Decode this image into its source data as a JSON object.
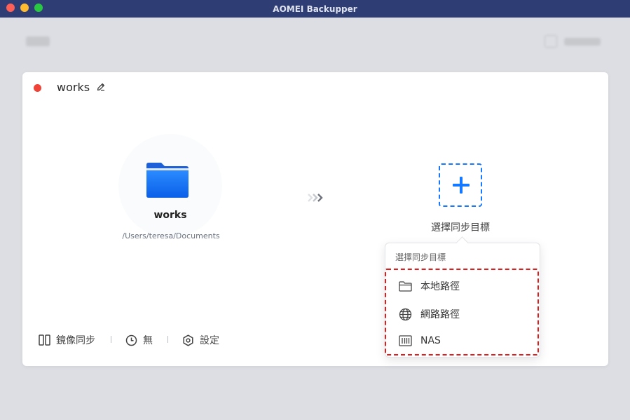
{
  "window": {
    "title": "AOMEI Backupper"
  },
  "task": {
    "name": "works",
    "status_color": "#f04438",
    "source": {
      "name": "works",
      "path": "/Users/teresa/Documents",
      "icon": "folder-icon"
    },
    "destination": {
      "label": "選擇同步目標",
      "icon": "plus-icon"
    }
  },
  "bottom_bar": {
    "mode_label": "鏡像同步",
    "schedule_label": "無",
    "settings_label": "設定"
  },
  "dest_menu": {
    "title": "選擇同步目標",
    "items": [
      {
        "label": "本地路徑",
        "icon": "folder-outline-icon"
      },
      {
        "label": "網路路徑",
        "icon": "globe-icon"
      },
      {
        "label": "NAS",
        "icon": "nas-icon"
      }
    ]
  },
  "colors": {
    "accent": "#1677ff",
    "highlight": "#e31b1b",
    "titlebar": "#2e3d73"
  }
}
